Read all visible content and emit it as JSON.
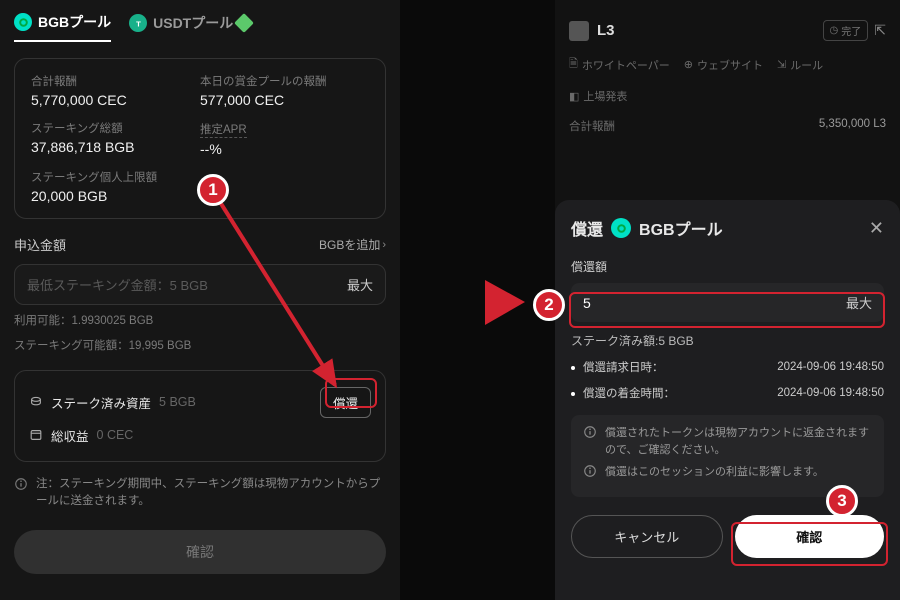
{
  "tabs": {
    "bgb": "BGBプール",
    "usdt": "USDTプール"
  },
  "stats": {
    "totalReward_lbl": "合計報酬",
    "totalReward_val": "5,770,000 CEC",
    "todayReward_lbl": "本日の賞金プールの報酬",
    "todayReward_val": "577,000 CEC",
    "stakeTotal_lbl": "ステーキング総額",
    "stakeTotal_val": "37,886,718 BGB",
    "apr_lbl": "推定APR",
    "apr_val": "--%",
    "cap_lbl": "ステーキング個人上限額",
    "cap_val": "20,000 BGB"
  },
  "apply": {
    "title": "申込金額",
    "addLink": "BGBを追加",
    "placeholder": "最低ステーキング金額：5 BGB",
    "max": "最大",
    "avail": "利用可能：1.9930025 BGB",
    "cap": "ステーキング可能額：19,995 BGB"
  },
  "staked": {
    "assets_lbl": "ステーク済み資産",
    "assets_val": "5 BGB",
    "redeem_btn": "償還",
    "earnings_lbl": "総収益",
    "earnings_val": "0 CEC"
  },
  "note": "注：ステーキング期間中、ステーキング額は現物アカウントからプールに送金されます。",
  "confirm": "確認",
  "right_under": {
    "title": "L3",
    "done": "完了",
    "links": {
      "wp": "ホワイトペーパー",
      "web": "ウェブサイト",
      "rule": "ルール",
      "listing": "上場発表"
    },
    "stat_lbl": "合計報酬",
    "stat_val": "5,350,000 L3"
  },
  "modal": {
    "title_prefix": "償還",
    "pool": "BGBプール",
    "amount_lbl": "償還額",
    "amount_val": "5",
    "max": "最大",
    "staked": "ステーク済み額:5 BGB",
    "req_lbl": "償還請求日時：",
    "req_val": "2024-09-06 19:48:50",
    "arr_lbl": "償還の着金時間：",
    "arr_val": "2024-09-06 19:48:50",
    "info1": "償還されたトークンは現物アカウントに返金されますので、ご確認ください。",
    "info2": "償還はこのセッションの利益に影響します。",
    "cancel": "キャンセル",
    "ok": "確認"
  },
  "badges": {
    "b1": "1",
    "b2": "2",
    "b3": "3"
  }
}
